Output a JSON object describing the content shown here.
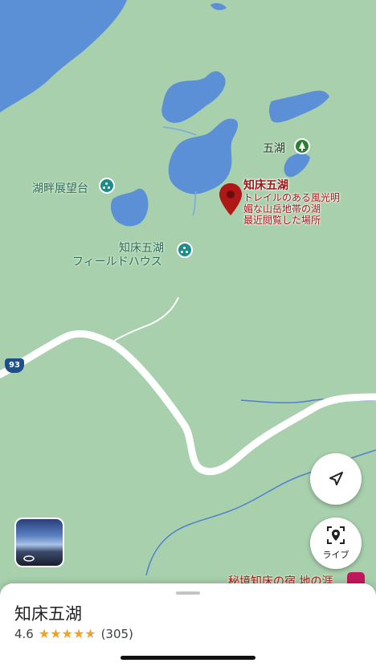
{
  "map": {
    "lakes": [
      {
        "name": "湖畔展望台",
        "type": "viewpoint"
      },
      {
        "name": "知床五湖\nフィールドハウス",
        "type": "visitor-center"
      }
    ],
    "poi_lake5": "五湖",
    "poi_viewpoint": "湖畔展望台",
    "poi_fieldhouse_line1": "知床五湖",
    "poi_fieldhouse_line2": "フィールドハウス",
    "pin": {
      "title": "知床五湖",
      "line1": "トレイルのある風光明",
      "line2": "媚な山岳地帯の湖",
      "line3": "最近閲覧した場所"
    },
    "bottom_label": "秘境知床の宿 地の涯",
    "highway_number": "93",
    "colors": {
      "land": "#a8d0ac",
      "water": "#5b8fd6",
      "road": "#ffffff",
      "pin": "#b01818"
    }
  },
  "controls": {
    "navigate_icon": "navigation-arrow-icon",
    "live_label": "ライブ",
    "live_icon": "live-view-pin-icon"
  },
  "sheet": {
    "title": "知床五湖",
    "rating": "4.6",
    "review_count": "(305)",
    "stars_value": 4.6
  }
}
